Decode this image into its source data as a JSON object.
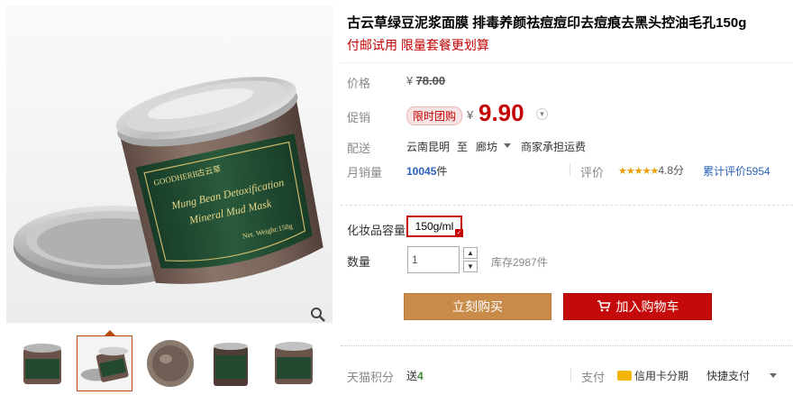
{
  "product": {
    "title": "古云草绿豆泥浆面膜 排毒养颜祛痘痘印去痘痕去黑头控油毛孔150g",
    "subtitle": "付邮试用 限量套餐更划算"
  },
  "image_text": {
    "brand": "GOODHERB",
    "brand_cn": "古云草",
    "line1": "Mung Bean Detoxification",
    "line2": "Mineral Mud Mask",
    "weight": "Net. Weight:150g"
  },
  "price": {
    "label": "价格",
    "currency": "¥",
    "original": "78.00"
  },
  "promo": {
    "label": "促销",
    "tag": "限时团购",
    "currency": "¥",
    "price": "9.90"
  },
  "shipping": {
    "label": "配送",
    "from": "云南昆明",
    "to_word": "至",
    "to": "廊坊",
    "fee": "商家承担运费"
  },
  "sales": {
    "label": "月销量",
    "count": "10045",
    "unit": "件",
    "rating_label": "评价",
    "stars": "★★★★★",
    "score": "4.8分",
    "reviews": "累计评价5954"
  },
  "sku": {
    "label": "化妆品容量",
    "option": "150g/ml",
    "check": "✓"
  },
  "quantity": {
    "label": "数量",
    "value": "1",
    "stock": "库存2987件",
    "up": "▲",
    "down": "▼"
  },
  "buttons": {
    "buy": "立刻购买",
    "cart": "加入购物车"
  },
  "footer": {
    "points_label": "天猫积分",
    "points_prefix": "送",
    "points_value": "4",
    "pay_label": "支付",
    "credit": "信用卡分期",
    "quick": "快捷支付"
  },
  "colors": {
    "accent_red": "#c40000",
    "buy_button": "#c98b4a",
    "cart_button": "#c40a0a",
    "link_blue": "#2a60b8",
    "jar_label_green": "#1f4a2e"
  },
  "icons": {
    "zoom": "magnifier-icon",
    "cart": "shopping-cart-icon",
    "credit": "credit-card-icon",
    "stars": "star-rating-icon"
  }
}
